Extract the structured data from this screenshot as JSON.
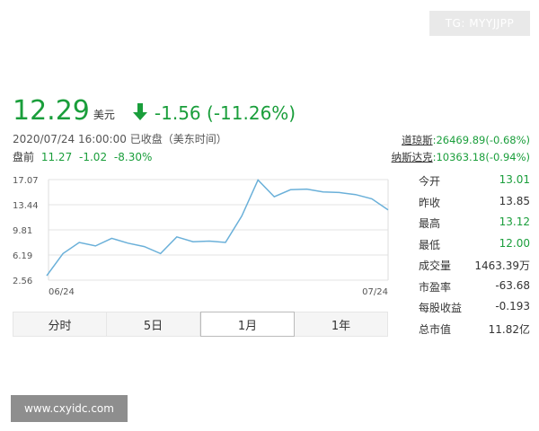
{
  "watermark_top": "TG: MYYJJPP",
  "watermark_bottom": "www.cxyidc.com",
  "quote": {
    "price": "12.29",
    "currency": "美元",
    "change": "-1.56 (-11.26%)",
    "timestamp": "2020/07/24 16:00:00 已收盘（美东时间）",
    "premarket_label": "盘前",
    "premarket_price": "11.27",
    "premarket_change": "-1.02",
    "premarket_pct": "-8.30%"
  },
  "indices": [
    {
      "name": "道琼斯",
      "value": ":26469.89(-0.68%)"
    },
    {
      "name": "纳斯达克",
      "value": ":10363.18(-0.94%)"
    }
  ],
  "colors": {
    "down": "#1a9e3b",
    "line": "#6ab0d9",
    "axis": "#e3e3e3"
  },
  "icons": {
    "change_direction": "arrow-down-icon"
  },
  "chart_data": {
    "type": "line",
    "x_start_label": "06/24",
    "x_end_label": "07/24",
    "y_ticks": [
      "17.07",
      "13.44",
      "9.81",
      "6.19",
      "2.56"
    ],
    "ylim": [
      2.56,
      17.07
    ],
    "grid": true,
    "series": [
      {
        "values": [
          3.2,
          6.4,
          8.0,
          7.5,
          8.6,
          7.9,
          7.4,
          6.4,
          8.8,
          8.1,
          8.2,
          8.0,
          11.8,
          17.0,
          14.6,
          15.6,
          15.7,
          15.3,
          15.2,
          14.9,
          14.3,
          12.7
        ]
      }
    ]
  },
  "stats": [
    {
      "label": "今开",
      "value": "13.01",
      "color": "green"
    },
    {
      "label": "昨收",
      "value": "13.85",
      "color": "dark"
    },
    {
      "label": "最高",
      "value": "13.12",
      "color": "green"
    },
    {
      "label": "最低",
      "value": "12.00",
      "color": "green"
    },
    {
      "label": "成交量",
      "value": "1463.39万",
      "color": "dark"
    },
    {
      "label": "市盈率",
      "value": "-63.68",
      "color": "dark"
    },
    {
      "label": "每股收益",
      "value": "-0.193",
      "color": "dark"
    },
    {
      "label": "总市值",
      "value": "11.82亿",
      "color": "dark"
    }
  ],
  "tabs": [
    {
      "label": "分时",
      "active": false
    },
    {
      "label": "5日",
      "active": false
    },
    {
      "label": "1月",
      "active": true
    },
    {
      "label": "1年",
      "active": false
    }
  ]
}
